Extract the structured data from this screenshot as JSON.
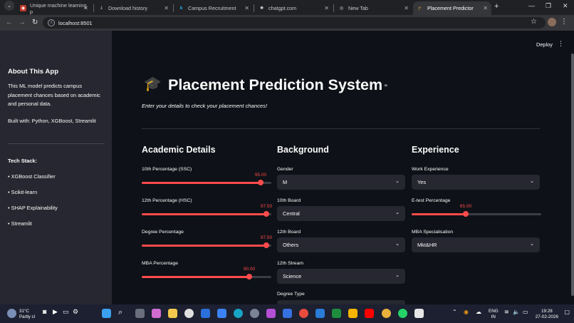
{
  "browser": {
    "tabs": [
      {
        "label": "Unique machine learning p",
        "active": false
      },
      {
        "label": "Download history",
        "active": false
      },
      {
        "label": "Campus Recruitment",
        "active": false
      },
      {
        "label": "chatgpt.com",
        "active": false
      },
      {
        "label": "New Tab",
        "active": false
      },
      {
        "label": "Placement Predictor",
        "active": true
      }
    ],
    "url": "localhost:8501"
  },
  "app": {
    "deploy_label": "Deploy",
    "title": "Placement Prediction System",
    "title_icon": "🎓",
    "subtitle": "Enter your details to check your placement chances!"
  },
  "sidebar": {
    "heading": "About This App",
    "description": "This ML model predicts campus placement chances based on academic and personal data.",
    "built_with": "Built with: Python, XGBoost, Streamlit",
    "tech_heading": "Tech Stack:",
    "tech_items": [
      "• XGBoost Classifier",
      "• Scikit-learn",
      "• SHAP Explainability",
      "• Streamlit"
    ]
  },
  "academic": {
    "heading": "Academic Details",
    "sliders": [
      {
        "label": "10th Percentage (SSC)",
        "value": "95.00",
        "fraction": 0.92
      },
      {
        "label": "12th Percentage (HSC)",
        "value": "97.50",
        "fraction": 0.96
      },
      {
        "label": "Degree Percentage",
        "value": "97.50",
        "fraction": 0.96
      },
      {
        "label": "MBA Percentage",
        "value": "90.00",
        "fraction": 0.83
      }
    ]
  },
  "background": {
    "heading": "Background",
    "fields": [
      {
        "label": "Gender",
        "value": "M"
      },
      {
        "label": "10th Board",
        "value": "Central"
      },
      {
        "label": "12th Board",
        "value": "Others"
      },
      {
        "label": "12th Stream",
        "value": "Science"
      },
      {
        "label": "Degree Type",
        "value": ""
      }
    ]
  },
  "experience": {
    "heading": "Experience",
    "work_label": "Work Experience",
    "work_value": "Yes",
    "etest_label": "E-test Percentage",
    "etest_value": "65.00",
    "etest_fraction": 0.42,
    "spec_label": "MBA Specialisation",
    "spec_value": "Mkt&HR"
  },
  "taskbar": {
    "temp": "31°C",
    "weather": "Partly cl",
    "lang1": "ENG",
    "lang2": "IN",
    "time": "19:28",
    "date": "27-02-2026"
  },
  "colors": {
    "accent": "#ff4b4b",
    "sidebar": "#262730",
    "main_bg": "#0e1117"
  }
}
